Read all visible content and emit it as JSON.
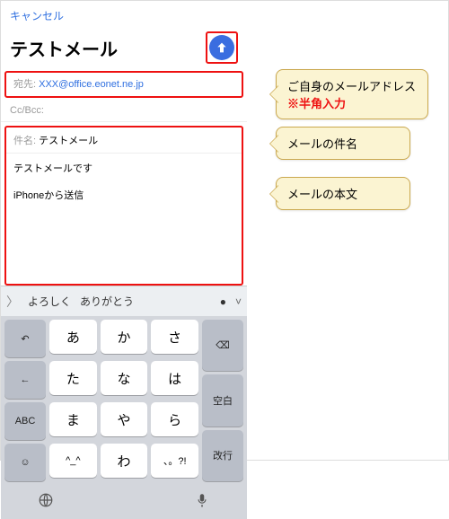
{
  "header": {
    "cancel": "キャンセル",
    "title": "テストメール"
  },
  "fields": {
    "to_label": "宛先:",
    "to_value": "XXX@office.eonet.ne.jp",
    "cc_label": "Cc/Bcc:",
    "subject_label": "件名:",
    "subject_value": "テストメール",
    "body": "テストメールです",
    "signature": "iPhoneから送信"
  },
  "predict": {
    "w1": "よろしく",
    "w2": "ありがとう"
  },
  "kbd": {
    "r1": [
      "あ",
      "か",
      "さ"
    ],
    "r2": [
      "た",
      "な",
      "は"
    ],
    "r3": [
      "ま",
      "や",
      "ら"
    ],
    "r4": [
      "^_^",
      "わ",
      "、。?!"
    ],
    "undo": "↶",
    "left": "←",
    "abc": "ABC",
    "emoji": "☺",
    "del": "⌫",
    "space": "空白",
    "enter": "改行"
  },
  "callouts": {
    "c1a": "ご自身のメールアドレス",
    "c1b": "※半角入力",
    "c2": "メールの件名",
    "c3": "メールの本文"
  }
}
